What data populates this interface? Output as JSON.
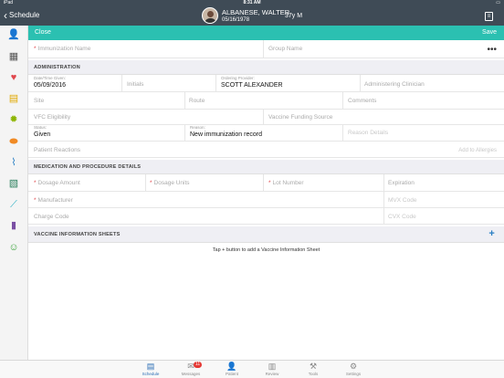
{
  "status_bar": {
    "carrier": "iPad",
    "time": "8:31 AM",
    "battery": "100%"
  },
  "header": {
    "back_label": "Schedule",
    "patient_name": "ALBANESE, WALTER",
    "patient_dob": "05/16/1978",
    "patient_age_sex": "37y M"
  },
  "sidebar": {
    "icons": [
      "patient-assign-icon",
      "calendar-icon",
      "heart-icon",
      "notes-icon",
      "virus-icon",
      "pill-icon",
      "test-tube-icon",
      "lab-report-icon",
      "syringe-icon",
      "bar-chart-icon",
      "person-icon"
    ]
  },
  "action_bar": {
    "close_label": "Close",
    "save_label": "Save"
  },
  "form": {
    "immunization_name_placeholder": "Immunization Name",
    "group_name_placeholder": "Group Name",
    "administration": {
      "title": "ADMINISTRATION",
      "date_time_caption": "Date/Time Given:",
      "date_time_value": "05/09/2016",
      "initials_placeholder": "Initials",
      "ordering_provider_caption": "Ordering Provider:",
      "ordering_provider_value": "SCOTT ALEXANDER",
      "administering_clinician_placeholder": "Administering Clinician",
      "site_placeholder": "Site",
      "route_placeholder": "Route",
      "comments_placeholder": "Comments",
      "vfc_eligibility_placeholder": "VFC Eligibility",
      "vaccine_funding_placeholder": "Vaccine Funding Source",
      "status_caption": "Status:",
      "status_value": "Given",
      "reason_caption": "Reason:",
      "reason_value": "New immunization record",
      "reason_details_placeholder": "Reason Details",
      "patient_reactions_placeholder": "Patient Reactions",
      "add_to_allergies_label": "Add to Allergies"
    },
    "medication": {
      "title": "MEDICATION AND PROCEDURE DETAILS",
      "dosage_amount_placeholder": "Dosage Amount",
      "dosage_units_placeholder": "Dosage Units",
      "lot_number_placeholder": "Lot Number",
      "expiration_placeholder": "Expiration",
      "manufacturer_placeholder": "Manufacturer",
      "mvx_code_placeholder": "MVX Code",
      "charge_code_placeholder": "Charge Code",
      "cvx_code_placeholder": "CVX Code"
    },
    "vis": {
      "title": "VACCINE INFORMATION SHEETS",
      "hint": "Tap + button to add a Vaccine Information Sheet"
    }
  },
  "tab_bar": {
    "tabs": [
      {
        "label": "Schedule",
        "icon": "schedule-icon",
        "active": true
      },
      {
        "label": "Messages",
        "icon": "messages-icon",
        "badge": "11"
      },
      {
        "label": "Patient",
        "icon": "patient-icon"
      },
      {
        "label": "Review",
        "icon": "review-icon"
      },
      {
        "label": "Tools",
        "icon": "tools-icon"
      },
      {
        "label": "Settings",
        "icon": "settings-icon"
      }
    ]
  },
  "colors": {
    "header": "#3f4b56",
    "accent": "#2bc0b1",
    "required": "#e0474c",
    "link": "#2a7fc4"
  }
}
